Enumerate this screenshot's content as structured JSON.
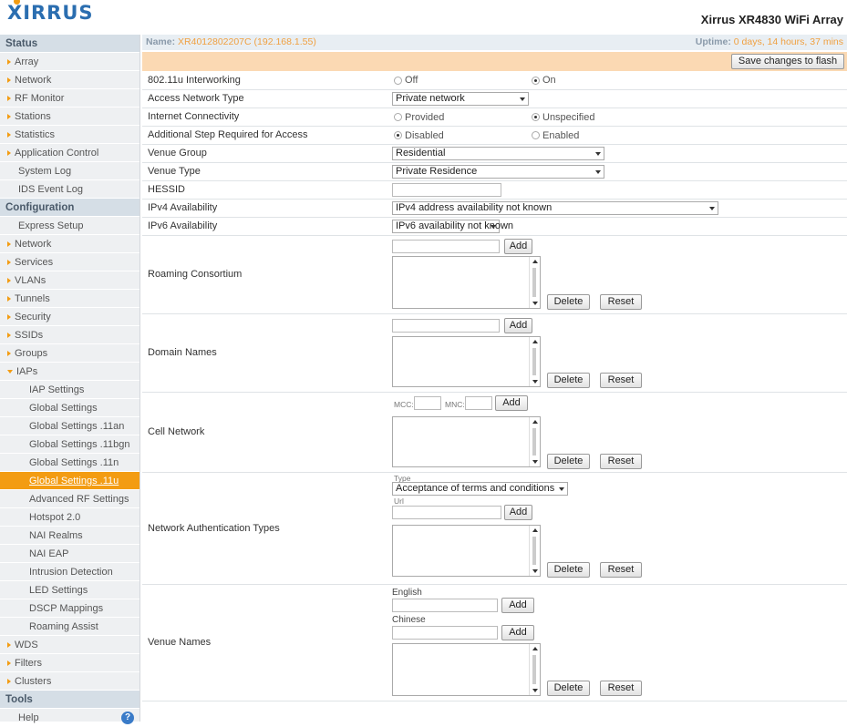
{
  "header": {
    "logo": "XIRRUS",
    "product": "Xirrus XR4830 WiFi Array"
  },
  "infobar": {
    "name_label": "Name:",
    "name_value": "XR4012802207C",
    "ip": "(192.168.1.55)",
    "uptime_label": "Uptime:",
    "uptime_value": "0 days, 14 hours, 37 mins"
  },
  "save_label": "Save changes to flash",
  "sidebar": {
    "status": "Status",
    "array": "Array",
    "network": "Network",
    "rf_monitor": "RF Monitor",
    "stations": "Stations",
    "statistics": "Statistics",
    "app_control": "Application Control",
    "system_log": "System Log",
    "ids_log": "IDS Event Log",
    "configuration": "Configuration",
    "express_setup": "Express Setup",
    "cfg_network": "Network",
    "services": "Services",
    "vlans": "VLANs",
    "tunnels": "Tunnels",
    "security": "Security",
    "ssids": "SSIDs",
    "groups": "Groups",
    "iaps": "IAPs",
    "iap_settings": "IAP Settings",
    "global_settings": "Global Settings",
    "gs_11an": "Global Settings .11an",
    "gs_11bgn": "Global Settings .11bgn",
    "gs_11n": "Global Settings .11n",
    "gs_11u": "Global Settings .11u",
    "adv_rf": "Advanced RF Settings",
    "hotspot": "Hotspot 2.0",
    "nai_realms": "NAI Realms",
    "nai_eap": "NAI EAP",
    "intrusion": "Intrusion Detection",
    "led": "LED Settings",
    "dscp": "DSCP Mappings",
    "roaming_assist": "Roaming Assist",
    "wds": "WDS",
    "filters": "Filters",
    "clusters": "Clusters",
    "tools": "Tools",
    "help": "Help"
  },
  "form": {
    "interworking": {
      "label": "802.11u Interworking",
      "off": "Off",
      "on": "On"
    },
    "access_network": {
      "label": "Access Network Type",
      "value": "Private network"
    },
    "internet": {
      "label": "Internet Connectivity",
      "provided": "Provided",
      "unspecified": "Unspecified"
    },
    "additional_step": {
      "label": "Additional Step Required for Access",
      "disabled": "Disabled",
      "enabled": "Enabled"
    },
    "venue_group": {
      "label": "Venue Group",
      "value": "Residential"
    },
    "venue_type": {
      "label": "Venue Type",
      "value": "Private Residence"
    },
    "hessid": {
      "label": "HESSID"
    },
    "ipv4": {
      "label": "IPv4 Availability",
      "value": "IPv4 address availability not known"
    },
    "ipv6": {
      "label": "IPv6 Availability",
      "value": "IPv6 availability not known"
    },
    "roaming": {
      "label": "Roaming Consortium"
    },
    "domain": {
      "label": "Domain Names"
    },
    "cell": {
      "label": "Cell Network",
      "mcc": "MCC:",
      "mnc": "MNC:"
    },
    "nat": {
      "label": "Network Authentication Types",
      "type_label": "Type",
      "type_value": "Acceptance of terms and conditions",
      "url_label": "Url"
    },
    "venue_names": {
      "label": "Venue Names",
      "english": "English",
      "chinese": "Chinese"
    },
    "add": "Add",
    "delete": "Delete",
    "reset": "Reset"
  }
}
